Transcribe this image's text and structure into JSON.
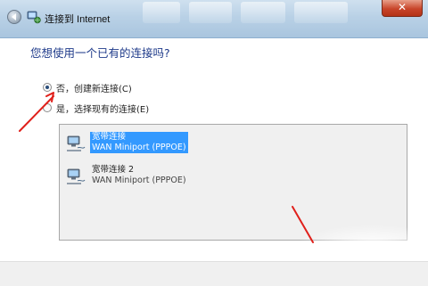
{
  "window": {
    "title": "连接到 Internet",
    "close_glyph": "✕"
  },
  "main": {
    "question": "您想使用一个已有的连接吗?",
    "options": [
      {
        "label": "否，创建新连接(C)",
        "checked": true
      },
      {
        "label": "是，选择现有的连接(E)",
        "checked": false
      }
    ],
    "connections": [
      {
        "name": "宽带连接",
        "device": "WAN Miniport (PPPOE)",
        "selected": true
      },
      {
        "name": "宽带连接 2",
        "device": "WAN Miniport (PPPOE)",
        "selected": false
      }
    ]
  },
  "icons": {
    "back": "back-arrow-icon",
    "app": "network-connection-icon",
    "connection": "network-computer-icon"
  },
  "colors": {
    "heading": "#1e3a8a",
    "selection": "#3399ff",
    "annotation": "#e0201b"
  }
}
